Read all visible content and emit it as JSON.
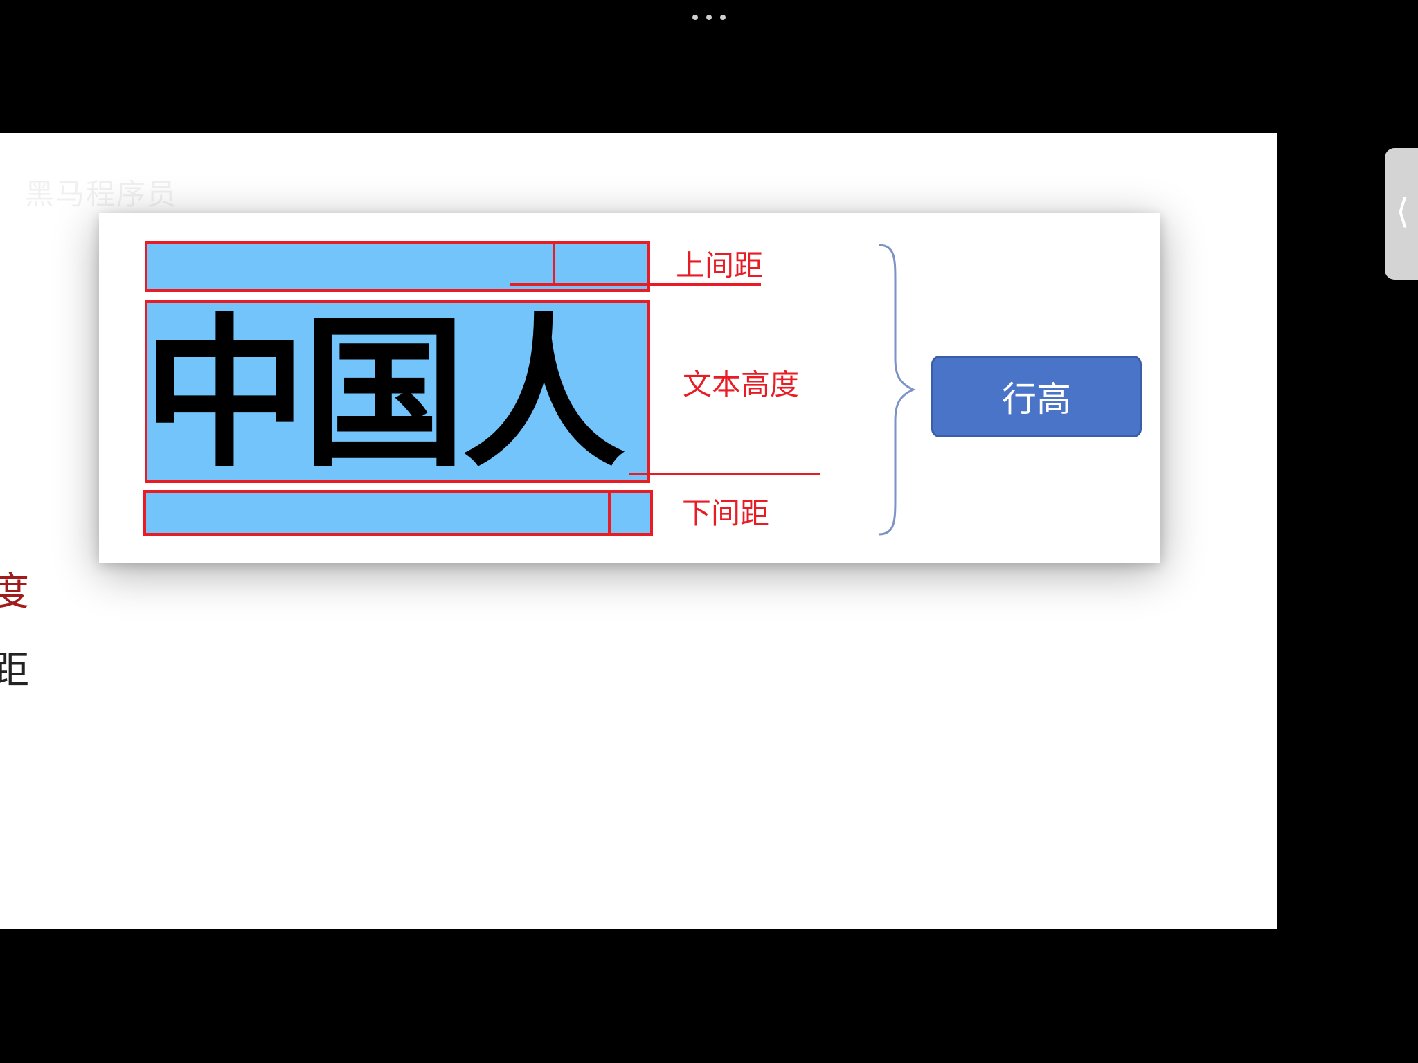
{
  "figure": {
    "big_text": "中国人",
    "labels": {
      "top_spacing": "上间距",
      "text_height": "文本高度",
      "bottom_spacing": "下间距"
    },
    "line_height_button": "行高"
  },
  "slide": {
    "watermark": "黑马程序员",
    "edge_text_1": "度",
    "edge_text_2": "距"
  },
  "colors": {
    "highlight_blue": "#73c4fb",
    "annotation_red": "#e81c24",
    "button_blue": "#4a74c7",
    "brace_blue": "#7d93c7"
  },
  "icons": {
    "menu": "more-dots-icon",
    "side_panel": "chevron-left-icon"
  }
}
